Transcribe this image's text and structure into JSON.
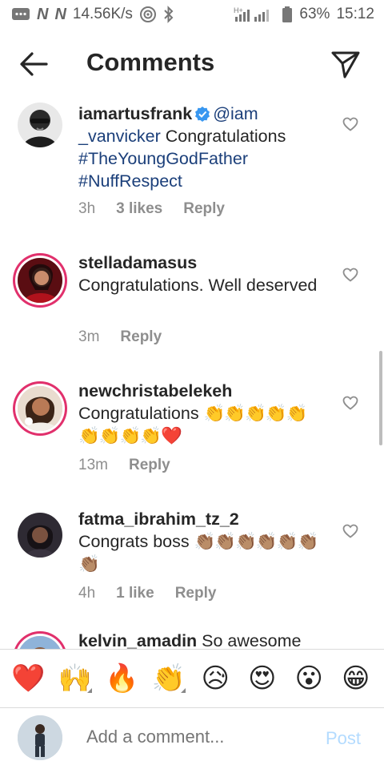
{
  "status_bar": {
    "network_label_1": "N",
    "network_label_2": "N",
    "speed": "14.56K/s",
    "battery_percent": "63%",
    "time": "15:12"
  },
  "header": {
    "title": "Comments"
  },
  "comments": [
    {
      "username": "iamartusfrank",
      "verified": true,
      "mention": "@iam _vanvicker",
      "text": " Congratulations ",
      "hashtags": [
        "#TheYoungGodFather",
        "#NuffRespect"
      ],
      "time": "3h",
      "likes": "3 likes",
      "reply": "Reply"
    },
    {
      "username": "stelladamasus",
      "text": "Congratulations. Well deserved",
      "time": "3m",
      "reply": "Reply"
    },
    {
      "username": "newchristabelekeh",
      "text": "Congratulations ",
      "emoji_line": "👏👏👏👏👏👏👏👏👏❤️",
      "time": "13m",
      "reply": "Reply"
    },
    {
      "username": "fatma_ibrahim_tz_2",
      "text": "Congrats boss ",
      "emoji_line": "👏🏽👏🏽👏🏽👏🏽👏🏽👏🏽👏🏽",
      "time": "4h",
      "likes": "1 like",
      "reply": "Reply"
    },
    {
      "username": "kelvin_amadin",
      "text": " So awesome"
    }
  ],
  "reactions": [
    {
      "emoji": "❤️",
      "icon": "heart-icon",
      "more": false
    },
    {
      "emoji": "🙌",
      "icon": "raising-hands-icon",
      "more": true
    },
    {
      "emoji": "🔥",
      "icon": "fire-icon",
      "more": false
    },
    {
      "emoji": "👏",
      "icon": "clapping-icon",
      "more": true
    },
    {
      "emoji": "😥",
      "icon": "sad-face-icon",
      "more": false
    },
    {
      "emoji": "😍",
      "icon": "heart-eyes-icon",
      "more": false
    },
    {
      "emoji": "😮",
      "icon": "surprised-icon",
      "more": false
    },
    {
      "emoji": "😁",
      "icon": "grinning-icon",
      "more": false
    }
  ],
  "composer": {
    "placeholder": "Add a comment...",
    "post_label": "Post"
  },
  "colors": {
    "link": "#1b3f7a",
    "verified": "#3897f0",
    "story_ring": "#e1306c",
    "post_disabled": "#b3dbff",
    "meta_grey": "#8e8e8e"
  }
}
